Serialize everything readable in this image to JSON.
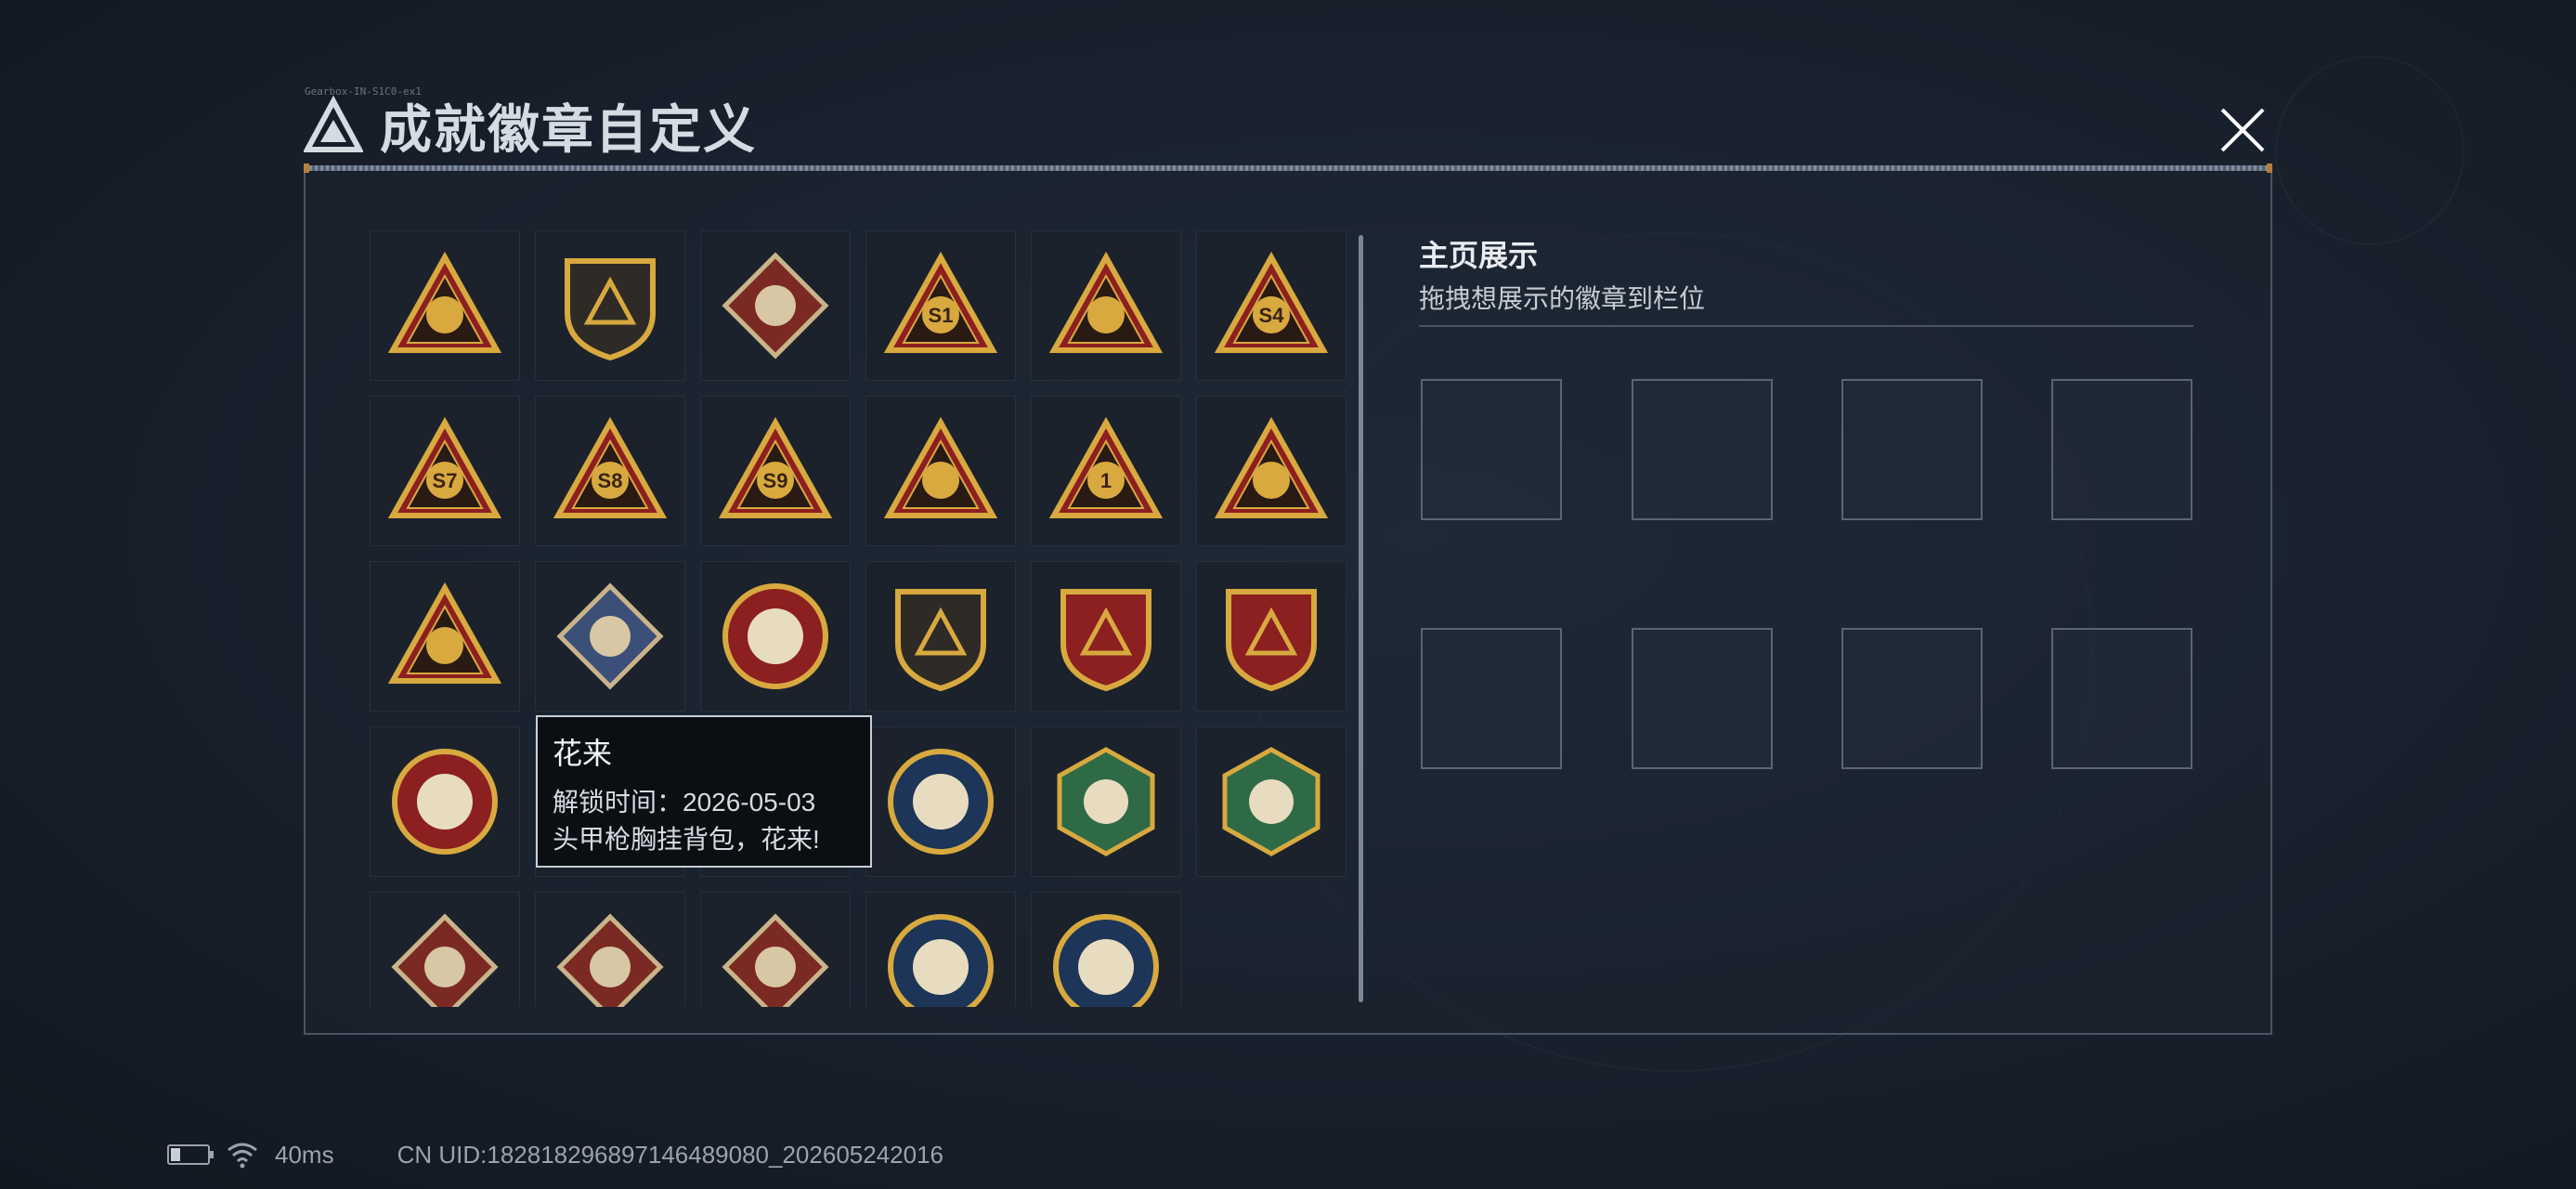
{
  "window": {
    "title": "成就徽章自定义",
    "corner_text": "Gearbox-IN-S1C0-ex1"
  },
  "showcase": {
    "title": "主页展示",
    "subtitle": "拖拽想展示的徽章到栏位",
    "slot_count": 8
  },
  "tooltip": {
    "name": "花来",
    "unlock_line": "解锁时间：2026-05-03",
    "description": "头甲枪胸挂背包，花来!"
  },
  "badges": [
    {
      "icon": "shield-triangle-logo-badge"
    },
    {
      "icon": "helicopter-shield-badge"
    },
    {
      "icon": "diamond-emblem-shield-badge"
    },
    {
      "icon": "s1-balloon-triangle-badge",
      "label": "S1"
    },
    {
      "icon": "radar-dish-triangle-badge"
    },
    {
      "icon": "s4-hourglass-triangle-badge",
      "label": "S4"
    },
    {
      "icon": "s7-tower-triangle-badge",
      "label": "S7"
    },
    {
      "icon": "s8-building-triangle-badge",
      "label": "S8"
    },
    {
      "icon": "s9-ship-triangle-badge",
      "label": "S9"
    },
    {
      "icon": "bowl-triangle-badge"
    },
    {
      "icon": "number-one-triangle-badge",
      "label": "1"
    },
    {
      "icon": "gem-hands-triangle-badge"
    },
    {
      "icon": "soldiers-triangle-badge"
    },
    {
      "icon": "blue-gem-diamond-badge"
    },
    {
      "icon": "star-compass-round-badge"
    },
    {
      "icon": "chevron-shield-badge"
    },
    {
      "icon": "blue-banner-shield-badge"
    },
    {
      "icon": "gem-banner-shield-badge"
    },
    {
      "icon": "stars-round-badge"
    },
    {
      "icon": "hidden-badge"
    },
    {
      "icon": "gold-chevron-shield-badge"
    },
    {
      "icon": "eagle-round-badge"
    },
    {
      "icon": "hornet-hexagon-badge"
    },
    {
      "icon": "medic-hexagon-badge"
    },
    {
      "icon": "dragon-diamond-badge"
    },
    {
      "icon": "dragon-diamond-badge-2"
    },
    {
      "icon": "runner-diamond-badge"
    },
    {
      "icon": "wolf-round-badge"
    },
    {
      "icon": "wolf-round-badge-2"
    }
  ],
  "status": {
    "ping": "40ms",
    "uid": "CN UID:18281829689714648908​0_202605242016",
    "battery_level": 0.25
  },
  "colors": {
    "gold": "#d8a93f",
    "red": "#8c1f1f",
    "navy": "#1c3558",
    "green": "#2f6a46",
    "panel_border": "#4a5564"
  }
}
